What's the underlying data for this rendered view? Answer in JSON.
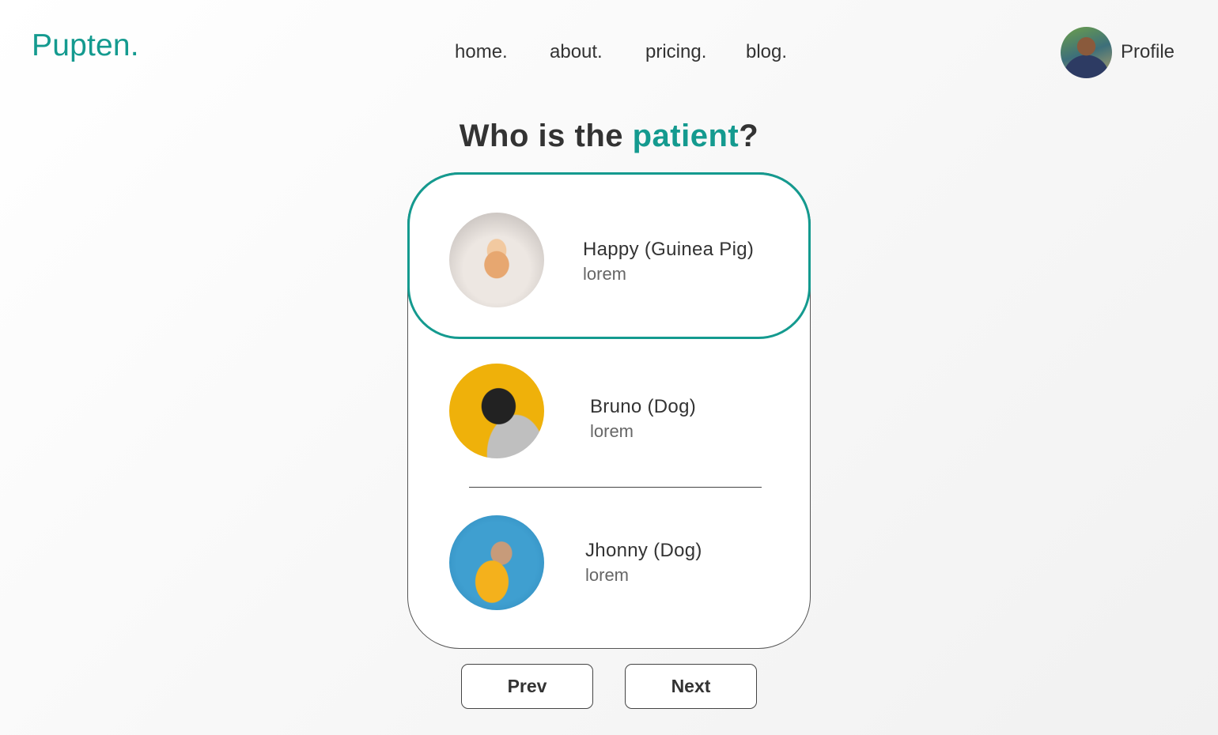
{
  "brand": {
    "logo": "Pupten."
  },
  "nav": {
    "items": [
      {
        "label": "home."
      },
      {
        "label": "about."
      },
      {
        "label": "pricing."
      },
      {
        "label": "blog."
      }
    ]
  },
  "profile": {
    "label": "Profile"
  },
  "heading": {
    "prefix": "Who is the ",
    "accent": "patient",
    "suffix": "?"
  },
  "patients": [
    {
      "name": "Happy (Guinea Pig)",
      "description": "lorem",
      "selected": true
    },
    {
      "name": "Bruno (Dog)",
      "description": "lorem",
      "selected": false
    },
    {
      "name": "Jhonny (Dog)",
      "description": "lorem",
      "selected": false
    }
  ],
  "pagination": {
    "prev_label": "Prev",
    "next_label": "Next"
  },
  "colors": {
    "accent": "#149a8f",
    "text": "#333333",
    "muted": "#666666"
  }
}
